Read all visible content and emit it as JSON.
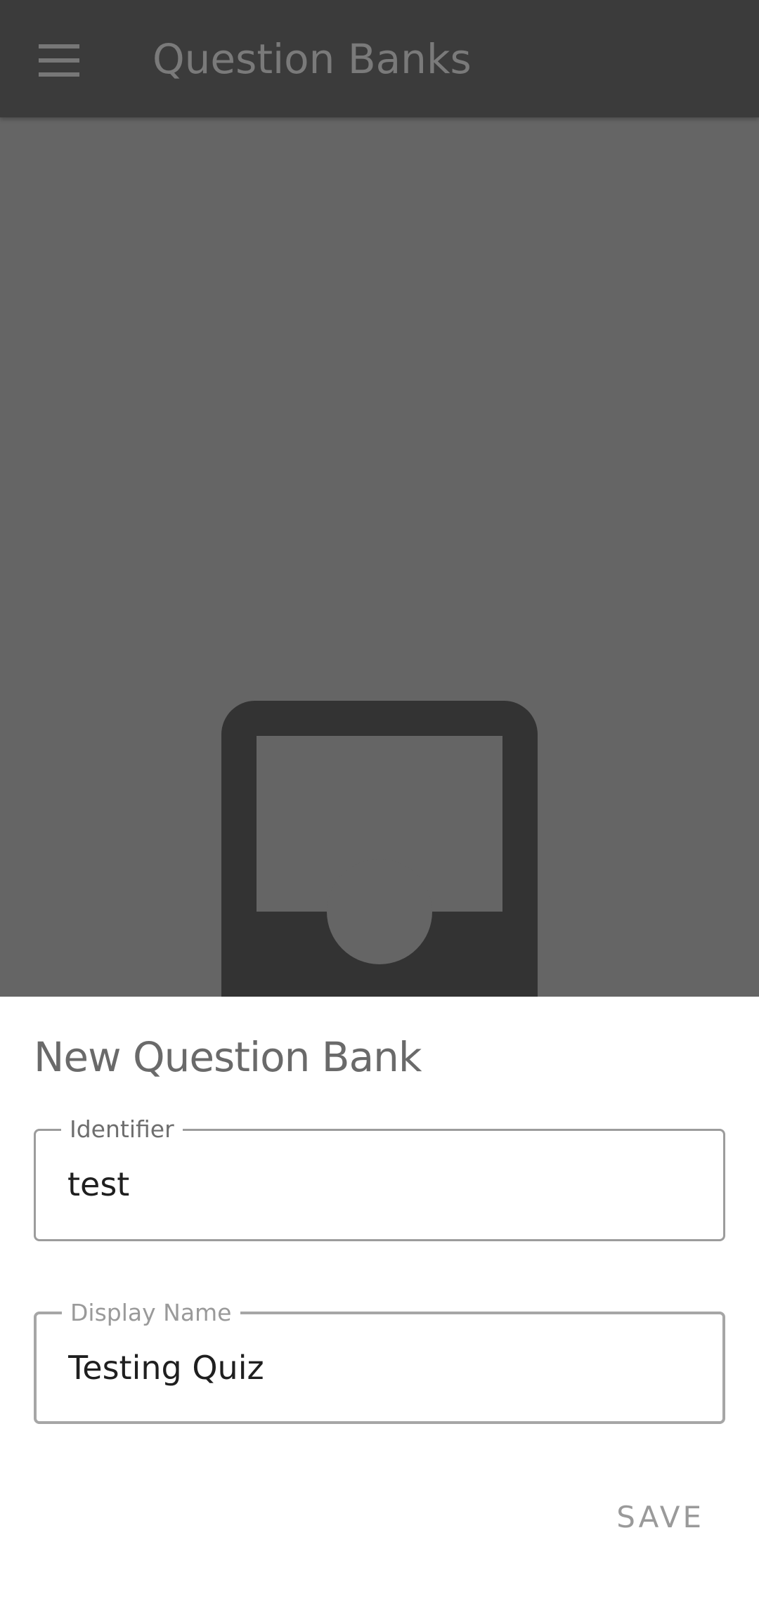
{
  "appbar": {
    "title": "Question Banks",
    "menu_icon": "hamburger-menu-icon"
  },
  "content": {
    "empty_icon": "inbox-icon"
  },
  "sheet": {
    "title": "New Question Bank",
    "identifier": {
      "label": "Identifier",
      "value": "test"
    },
    "display_name": {
      "label": "Display Name",
      "value": "Testing Quiz"
    },
    "save_label": "SAVE"
  },
  "colors": {
    "appbar_bg": "#3b3b3b",
    "scrim_content_bg": "#656565",
    "icon_dark": "#333333",
    "sheet_bg": "#ffffff"
  }
}
